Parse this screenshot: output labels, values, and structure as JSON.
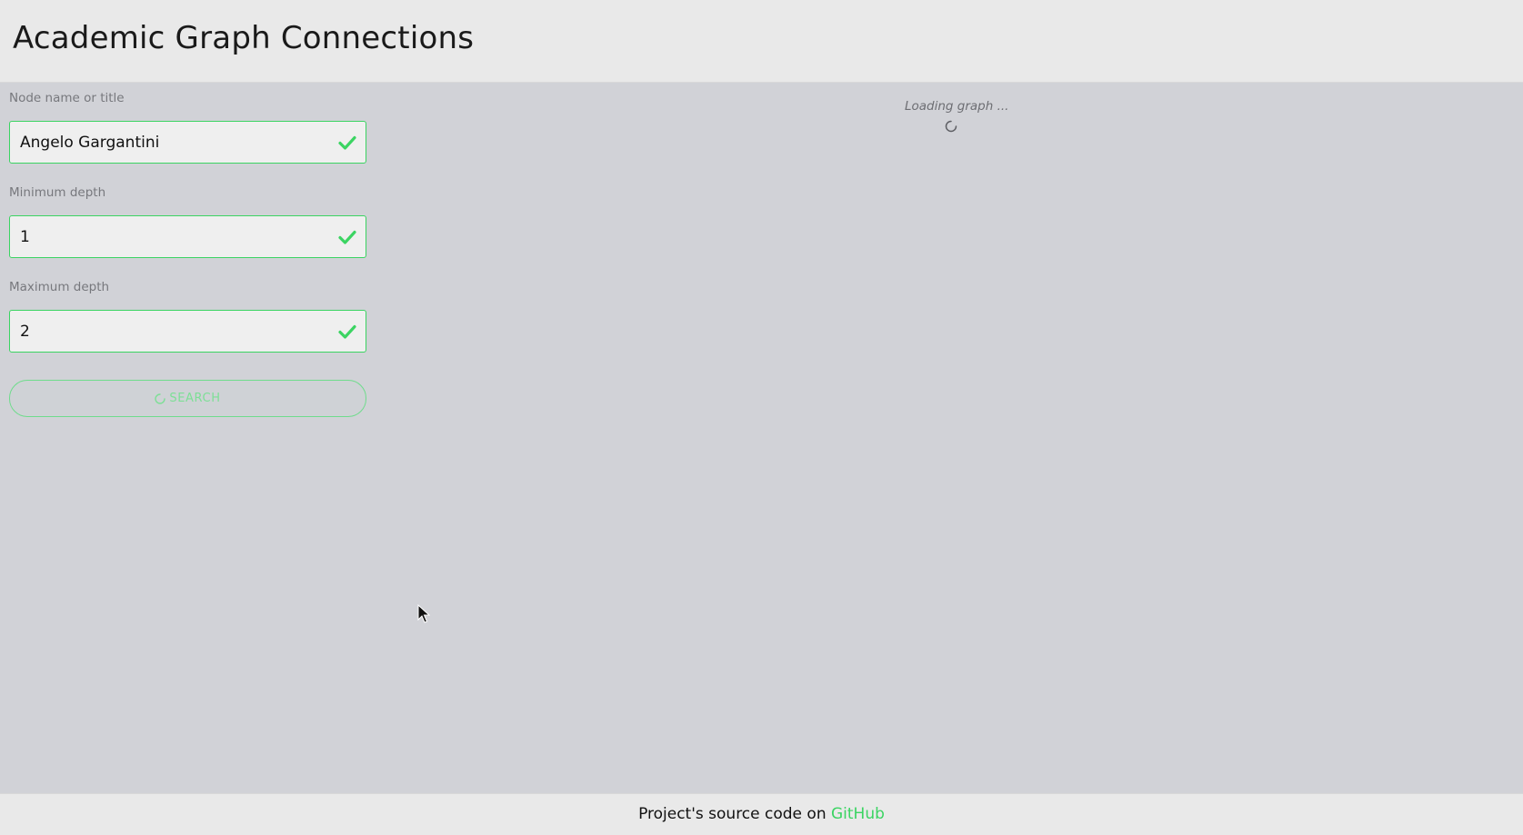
{
  "header": {
    "title": "Academic Graph Connections"
  },
  "form": {
    "node_label": "Node name or title",
    "node_value": "Angelo Gargantini",
    "min_depth_label": "Minimum depth",
    "min_depth_value": "1",
    "max_depth_label": "Maximum depth",
    "max_depth_value": "2",
    "search_label": "SEARCH"
  },
  "graph": {
    "loading_text": "Loading graph ..."
  },
  "footer": {
    "prefix": "Project's source code on ",
    "link_text": "GitHub"
  },
  "colors": {
    "accent": "#3bd462",
    "background": "#d1d2d7",
    "header_bg": "#e9e9e9"
  },
  "icons": {
    "valid": "check-icon",
    "loading": "spinner-icon"
  }
}
